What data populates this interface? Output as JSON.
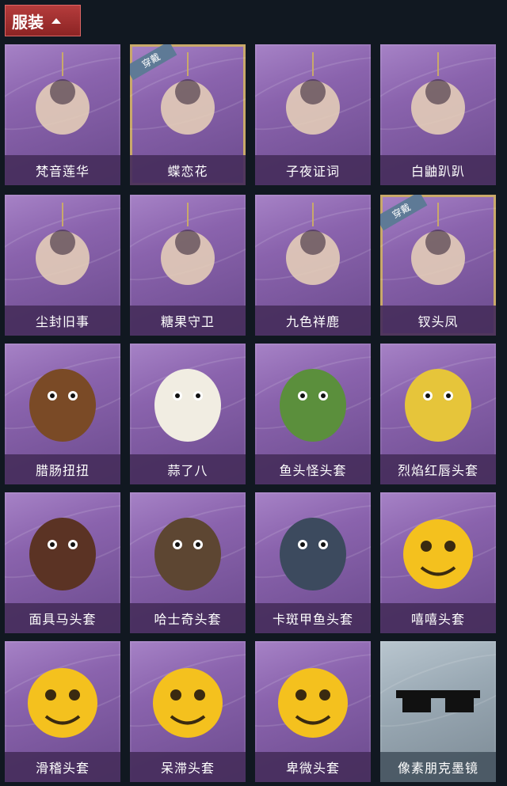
{
  "header": {
    "title": "服装",
    "icon": "chevron-up-icon"
  },
  "items": [
    {
      "name": "梵音莲华",
      "art": "bust-charm-icon",
      "equipped": false
    },
    {
      "name": "蝶恋花",
      "art": "bell-charm-icon",
      "equipped": true
    },
    {
      "name": "子夜证词",
      "art": "plague-doctor-charm-icon",
      "equipped": false
    },
    {
      "name": "白鼬趴趴",
      "art": "ermine-charm-icon",
      "equipped": false
    },
    {
      "name": "尘封旧事",
      "art": "figure-charm-icon",
      "equipped": false
    },
    {
      "name": "糖果守卫",
      "art": "pumpkin-charm-icon",
      "equipped": false
    },
    {
      "name": "九色祥鹿",
      "art": "deer-charm-icon",
      "equipped": false
    },
    {
      "name": "钗头凤",
      "art": "phoenix-crown-charm-icon",
      "equipped": true
    },
    {
      "name": "腊肠扭扭",
      "art": "dachshund-mask-icon",
      "equipped": false
    },
    {
      "name": "蒜了八",
      "art": "garlic-mask-icon",
      "equipped": false
    },
    {
      "name": "鱼头怪头套",
      "art": "fish-mask-icon",
      "equipped": false
    },
    {
      "name": "烈焰红唇头套",
      "art": "yellow-mask-icon",
      "equipped": false
    },
    {
      "name": "面具马头套",
      "art": "horse-mask-icon",
      "equipped": false
    },
    {
      "name": "哈士奇头套",
      "art": "husky-mask-icon",
      "equipped": false
    },
    {
      "name": "卡斑甲鱼头套",
      "art": "turtle-mask-icon",
      "equipped": false
    },
    {
      "name": "嘻嘻头套",
      "art": "grin-emoji-mask-icon",
      "equipped": false
    },
    {
      "name": "滑稽头套",
      "art": "smirk-emoji-mask-icon",
      "equipped": false
    },
    {
      "name": "呆滞头套",
      "art": "stare-emoji-mask-icon",
      "equipped": false
    },
    {
      "name": "卑微头套",
      "art": "humble-emoji-mask-icon",
      "equipped": false
    },
    {
      "name": "像素朋克墨镜",
      "art": "pixel-sunglasses-icon",
      "equipped": false,
      "rare": true
    }
  ],
  "equipped_badge": "穿戴",
  "colors": {
    "header_bg": "#a83232",
    "card_purple": "#8a63ad",
    "card_rare": "#9aa9b4",
    "equipped_border": "#c9a96a"
  }
}
